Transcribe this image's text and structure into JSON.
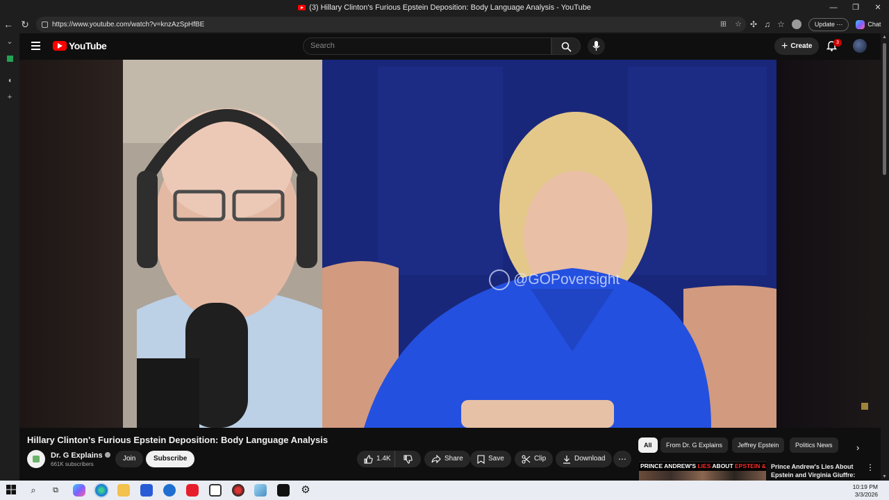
{
  "window": {
    "title": "(3) Hillary Clinton's Furious Epstein Deposition: Body Language Analysis - YouTube",
    "minimize": "—",
    "restore": "❐",
    "close": "✕"
  },
  "browser": {
    "url": "https://www.youtube.com/watch?v=knzAzSpHfBE",
    "update_label": "Update",
    "chat_label": "Chat"
  },
  "youtube": {
    "logo_text": "YouTube",
    "search_placeholder": "Search",
    "create_label": "Create",
    "notification_count": "3"
  },
  "video": {
    "watermark": "@GOPoversight",
    "title": "Hillary Clinton's Furious Epstein Deposition: Body Language Analysis",
    "channel": "Dr. G Explains",
    "subscribers": "661K subscribers",
    "join_label": "Join",
    "subscribe_label": "Subscribe",
    "likes": "1.4K",
    "share_label": "Share",
    "save_label": "Save",
    "clip_label": "Clip",
    "download_label": "Download"
  },
  "chips": [
    "All",
    "From Dr. G Explains",
    "Jeffrey Epstein",
    "Politics News"
  ],
  "related": {
    "thumb_text_1": "PRINCE ANDREW'S ",
    "thumb_text_red": "LIES",
    "thumb_text_2": " ABOUT ",
    "thumb_text_red2": "EPSTEIN & VIRGINIA",
    "title": "Prince Andrew's Lies About Epstein and Virginia Giuffre: ..."
  },
  "taskbar": {
    "time": "10:19 PM",
    "date": "3/3/2026"
  },
  "colors": {
    "youtube_red": "#ff0000",
    "background": "#0f0f0f",
    "button_bg": "#272727"
  }
}
